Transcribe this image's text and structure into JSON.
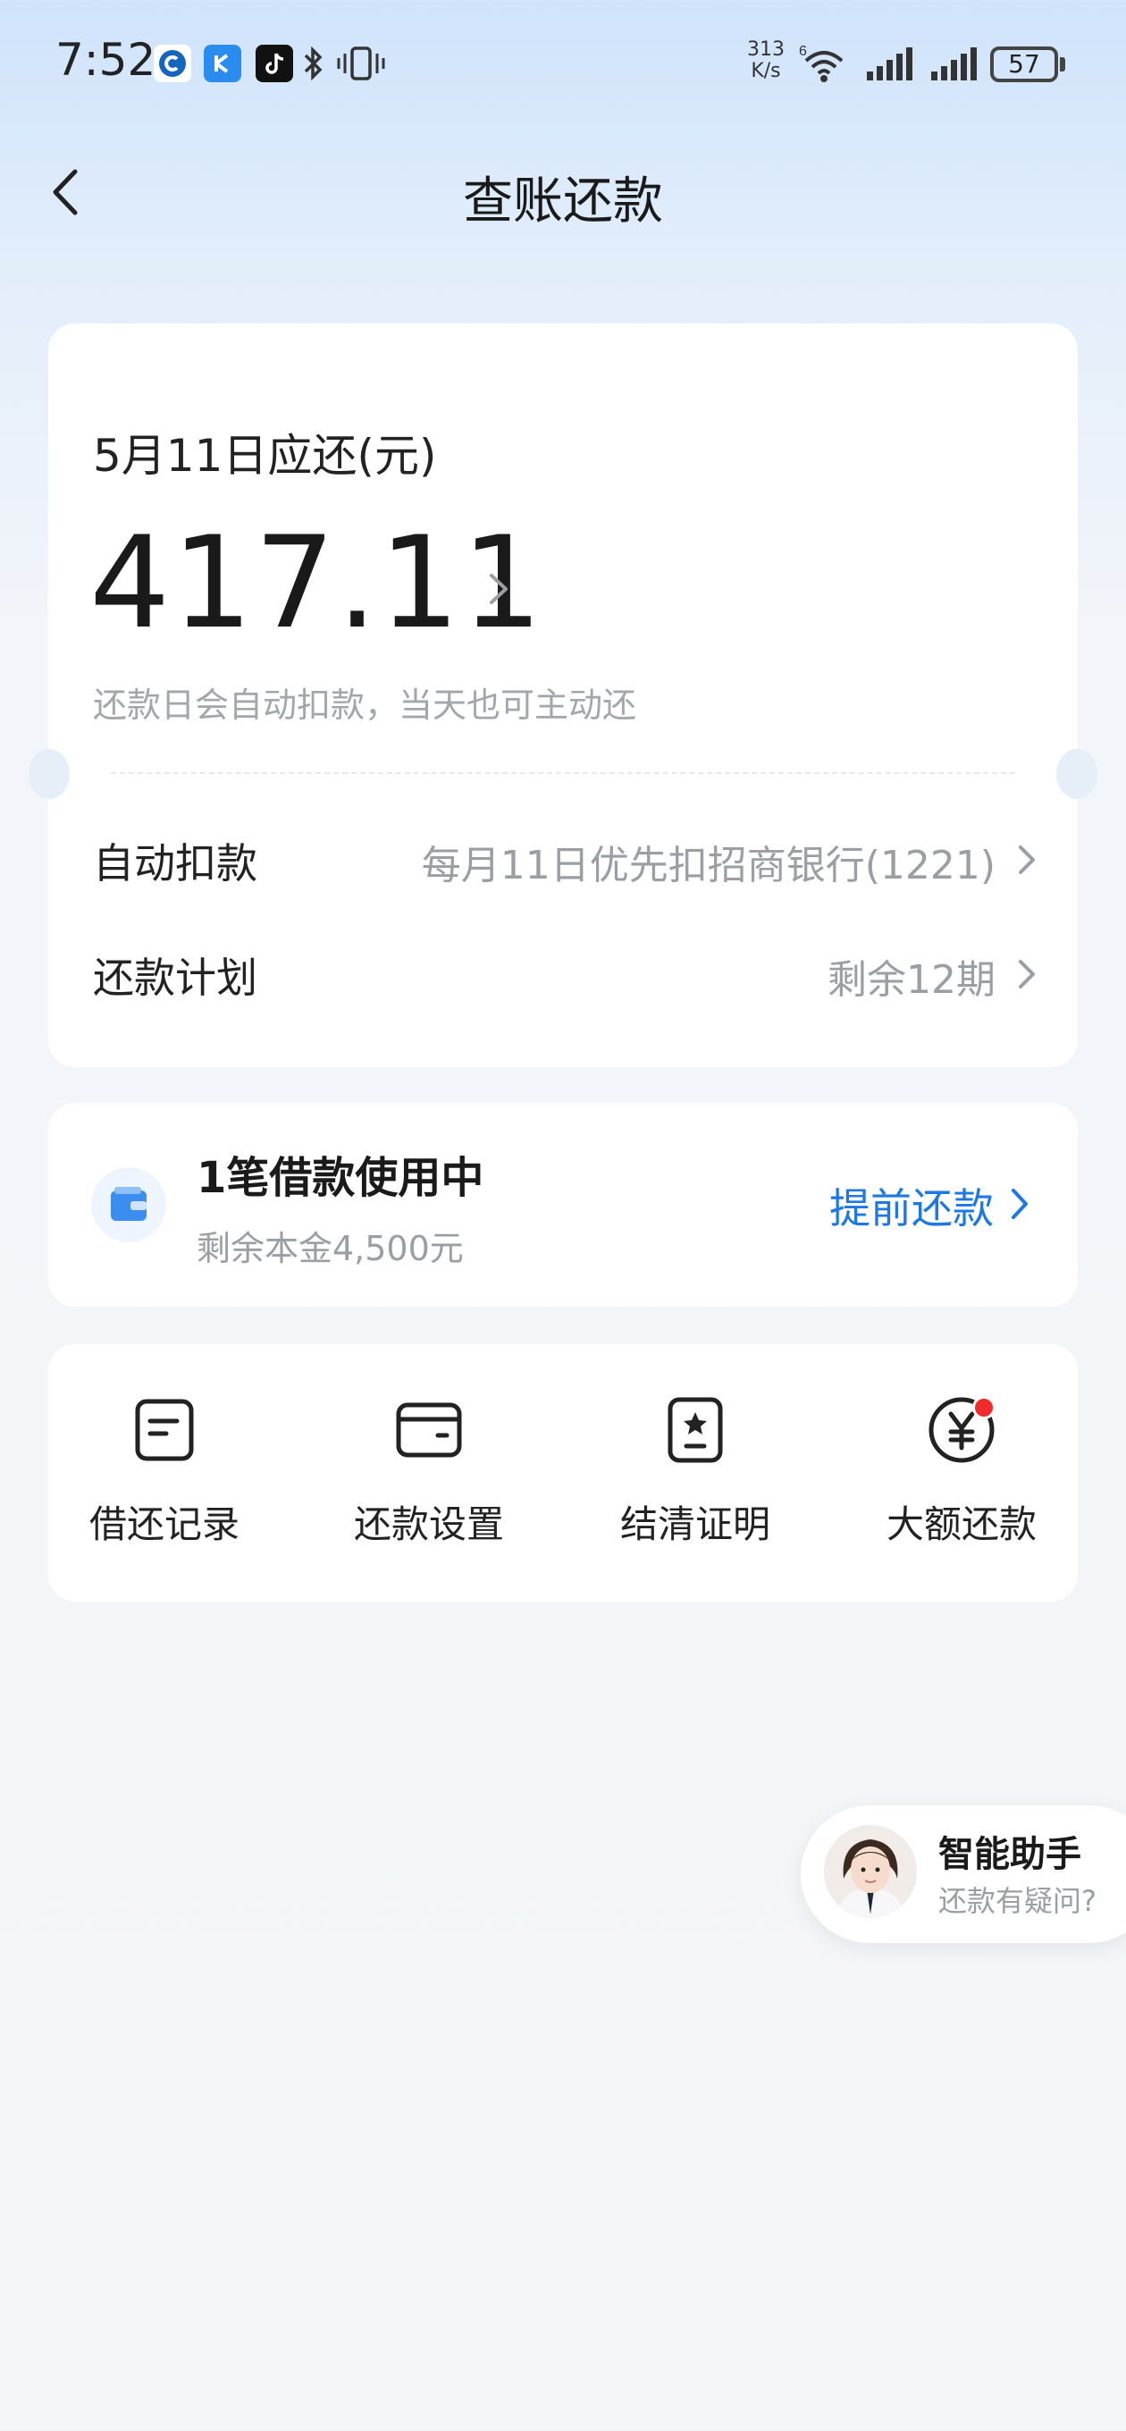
{
  "status_bar": {
    "time": "7:52",
    "net_speed_value": "313",
    "net_speed_unit": "K/s",
    "battery": "57",
    "icons": [
      "app-icon-c",
      "app-icon-k",
      "tiktok-icon",
      "bluetooth-icon",
      "vibrate-icon",
      "wifi-icon",
      "signal-icon",
      "signal-icon"
    ]
  },
  "header": {
    "title": "查账还款"
  },
  "due": {
    "label": "5月11日应还(元)",
    "amount": "417.11",
    "hint": "还款日会自动扣款，当天也可主动还"
  },
  "rows": {
    "auto_debit_label": "自动扣款",
    "auto_debit_value": "每月11日优先扣招商银行(1221)",
    "plan_label": "还款计划",
    "plan_value": "剩余12期"
  },
  "loan": {
    "title": "1笔借款使用中",
    "remaining": "剩余本金4,500元",
    "prepay_label": "提前还款"
  },
  "tools": [
    {
      "label": "借还记录",
      "icon": "record-icon"
    },
    {
      "label": "还款设置",
      "icon": "card-icon"
    },
    {
      "label": "结清证明",
      "icon": "certificate-icon"
    },
    {
      "label": "大额还款",
      "icon": "yuan-icon"
    }
  ],
  "assistant": {
    "title": "智能助手",
    "subtitle": "还款有疑问?"
  },
  "colors": {
    "accent": "#1d78e5",
    "badge": "#f02b2b"
  }
}
